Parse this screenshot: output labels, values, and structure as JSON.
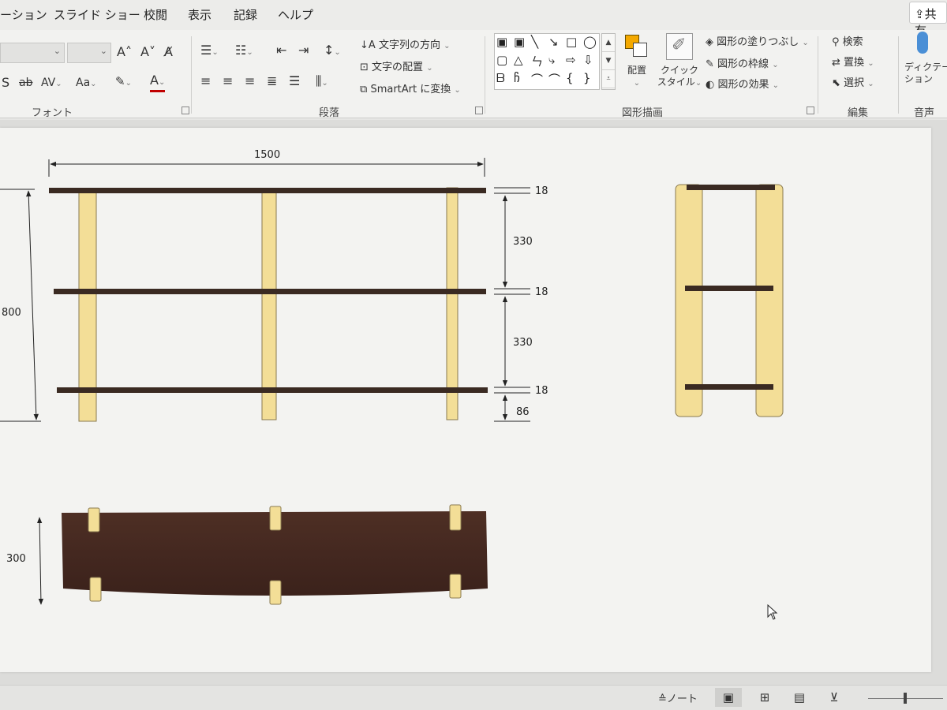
{
  "tabs": [
    {
      "label": "ーション"
    },
    {
      "label": "スライド ショー"
    },
    {
      "label": "校閲"
    },
    {
      "label": "表示"
    },
    {
      "label": "記録"
    },
    {
      "label": "ヘルプ"
    }
  ],
  "share_label": "共有",
  "ribbon": {
    "font": {
      "group_label": "フォント",
      "grow": "A˄",
      "shrink": "A˅",
      "clear": "A̸",
      "strike": "ab",
      "bold_partial": "S",
      "spacing": "AV",
      "case": "Aa"
    },
    "paragraph": {
      "group_label": "段落",
      "text_direction": "文字列の方向",
      "align_text": "文字の配置",
      "smartart": "SmartArt に変換"
    },
    "drawing": {
      "group_label": "図形描画",
      "arrange": "配置",
      "quick_styles_1": "クイック",
      "quick_styles_2": "スタイル",
      "shape_fill": "図形の塗りつぶし",
      "shape_outline": "図形の枠線",
      "shape_effects": "図形の効果"
    },
    "editing": {
      "group_label": "編集",
      "find": "検索",
      "replace": "置換",
      "select": "選択"
    },
    "voice": {
      "group_label": "音声",
      "dictate_1": "ディクテー",
      "dictate_2": "ション"
    }
  },
  "drawing_dims": {
    "width": "1500",
    "height": "800",
    "board1": "18",
    "gap1": "330",
    "board2": "18",
    "gap2": "330",
    "board3": "18",
    "bottom": "86",
    "depth": "300"
  },
  "colors": {
    "board": "#3a2a22",
    "leg": "#f3de97",
    "leg_stroke": "#8a7a50",
    "walnut": "#4a2c22"
  },
  "statusbar": {
    "notes": "ノート"
  }
}
